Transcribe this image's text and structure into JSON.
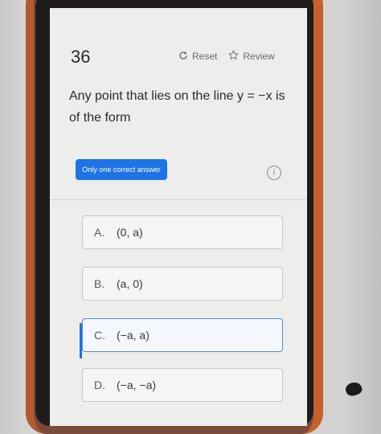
{
  "question": {
    "number": "36",
    "text": "Any point that lies on the line y = −x is of the form"
  },
  "toolbar": {
    "reset_label": "Reset",
    "review_label": "Review"
  },
  "badge": {
    "label": "Only one correct answer"
  },
  "info": {
    "symbol": "i"
  },
  "options": [
    {
      "letter": "A.",
      "text": "(0, a)"
    },
    {
      "letter": "B.",
      "text": "(a, 0)"
    },
    {
      "letter": "C.",
      "text": "(−a, a)"
    },
    {
      "letter": "D.",
      "text": "(−a, −a)"
    }
  ],
  "selected_option": "C."
}
